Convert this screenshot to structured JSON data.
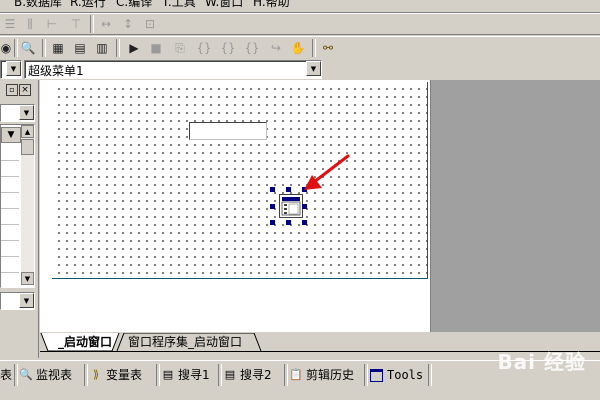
{
  "menu": {
    "items": [
      {
        "label": "B.数据库"
      },
      {
        "label": "R.运行"
      },
      {
        "label": "C.编译"
      },
      {
        "label": "T.工具"
      },
      {
        "label": "W.窗口"
      },
      {
        "label": "H.帮助"
      }
    ]
  },
  "toolbar_row2": {
    "icons": [
      "stop-icon",
      "clone-icon",
      "bracket-left-icon",
      "bracket-right-icon",
      "bracket-hash-icon",
      "hand-icon",
      "binoculars-icon"
    ]
  },
  "combo": {
    "left_value": "",
    "menu_select_value": "超级菜单1"
  },
  "designer": {
    "textbox_value": ""
  },
  "tabs": [
    {
      "label": "_启动窗口"
    },
    {
      "label": "窗口程序集_启动窗口"
    }
  ],
  "statusbar": {
    "items": [
      {
        "label": "表",
        "icon": ""
      },
      {
        "label": "监视表",
        "icon": "magnifier-icon"
      },
      {
        "label": "变量表",
        "icon": "variables-icon"
      },
      {
        "label": "搜寻1",
        "icon": "search-doc-icon"
      },
      {
        "label": "搜寻2",
        "icon": "search-doc-icon"
      },
      {
        "label": "剪辑历史",
        "icon": "clipboard-icon"
      },
      {
        "label": "Tools",
        "icon": "window-icon"
      }
    ]
  },
  "watermark": {
    "text": "Bai 经验"
  },
  "colors": {
    "face": "#d4d0c8",
    "canvas_bg": "#a0a0a0",
    "selection_handle": "#000080",
    "arrow": "#e01010",
    "design_border": "#0c5a6c"
  }
}
